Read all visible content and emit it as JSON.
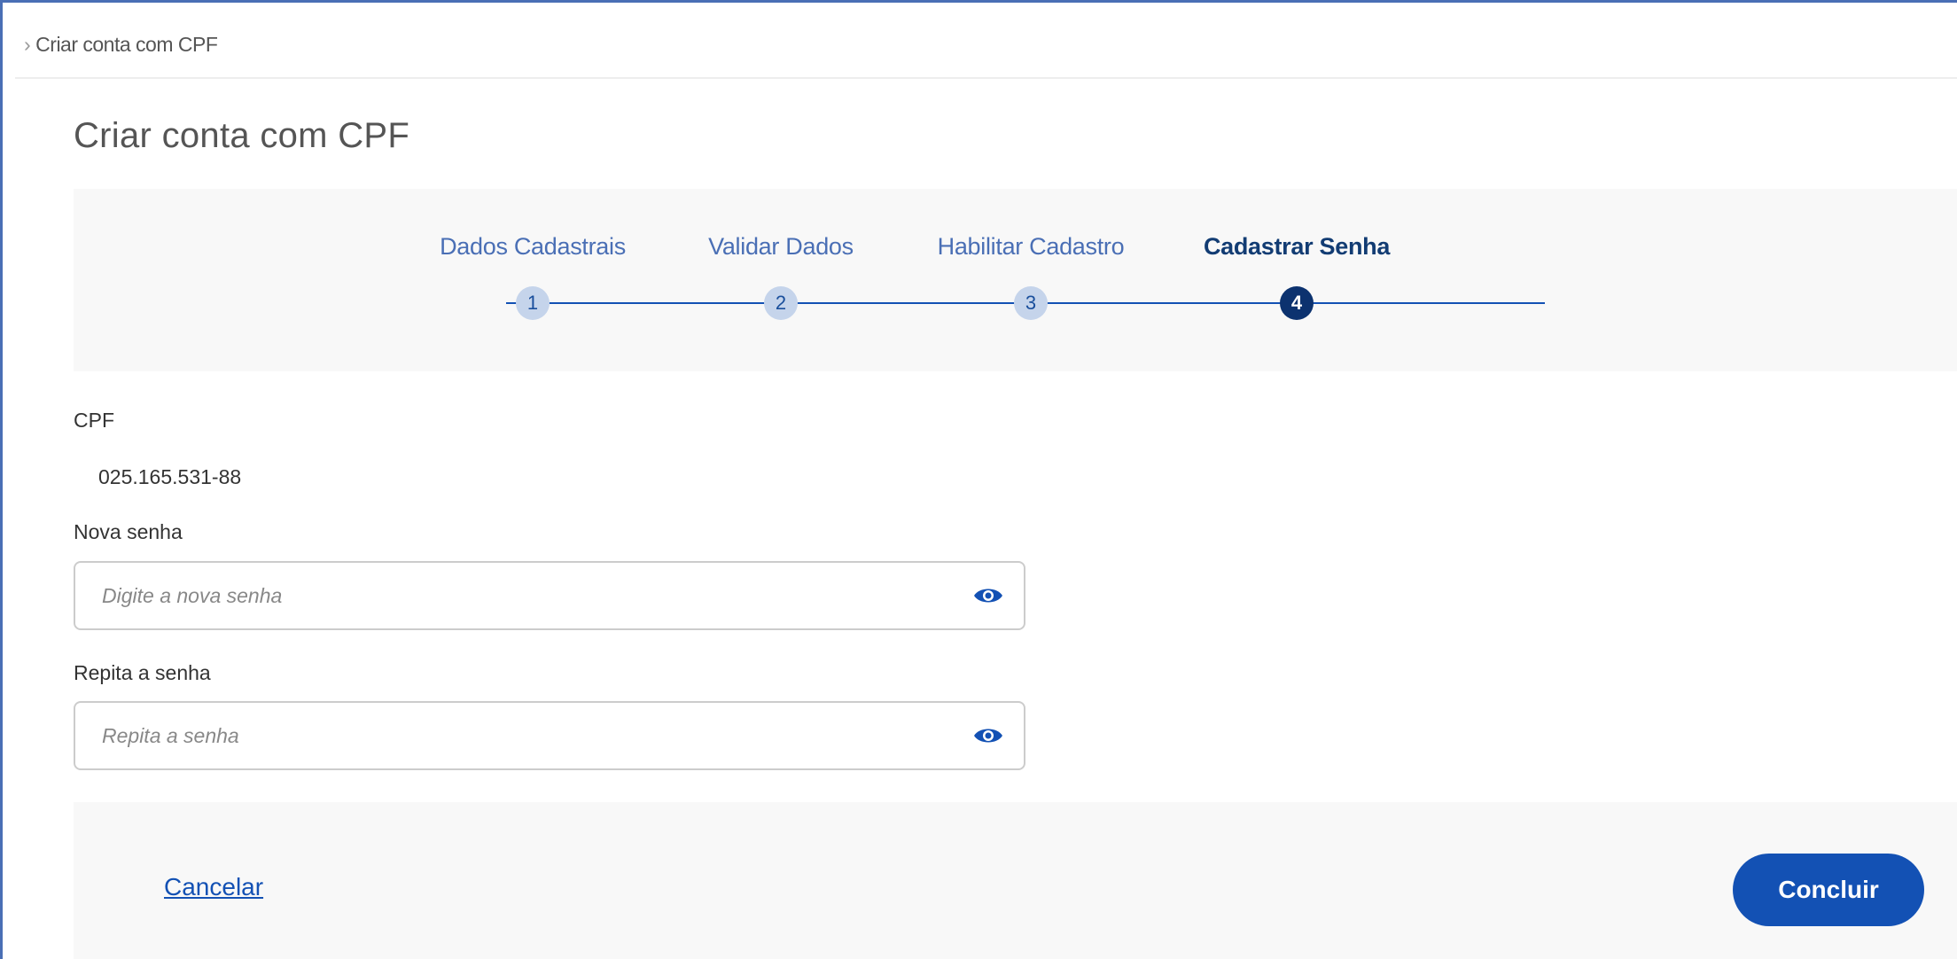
{
  "breadcrumb": {
    "separator": "›",
    "current": "Criar conta com CPF"
  },
  "page": {
    "title": "Criar conta com CPF"
  },
  "stepper": {
    "steps": [
      {
        "label": "Dados Cadastrais",
        "number": "1",
        "active": false
      },
      {
        "label": "Validar Dados",
        "number": "2",
        "active": false
      },
      {
        "label": "Habilitar Cadastro",
        "number": "3",
        "active": false
      },
      {
        "label": "Cadastrar Senha",
        "number": "4",
        "active": true
      }
    ]
  },
  "form": {
    "cpf_label": "CPF",
    "cpf_value": "025.165.531-88",
    "new_password": {
      "label": "Nova senha",
      "placeholder": "Digite a nova senha",
      "value": ""
    },
    "repeat_password": {
      "label": "Repita a senha",
      "placeholder": "Repita a senha",
      "value": ""
    }
  },
  "actions": {
    "cancel_label": "Cancelar",
    "submit_label": "Concluir"
  },
  "colors": {
    "primary": "#1351b4",
    "active_step": "#0c326f",
    "inactive_step": "#c5d4eb",
    "panel_background": "#f8f8f8"
  },
  "icons": {
    "password_toggle": "eye-icon"
  }
}
